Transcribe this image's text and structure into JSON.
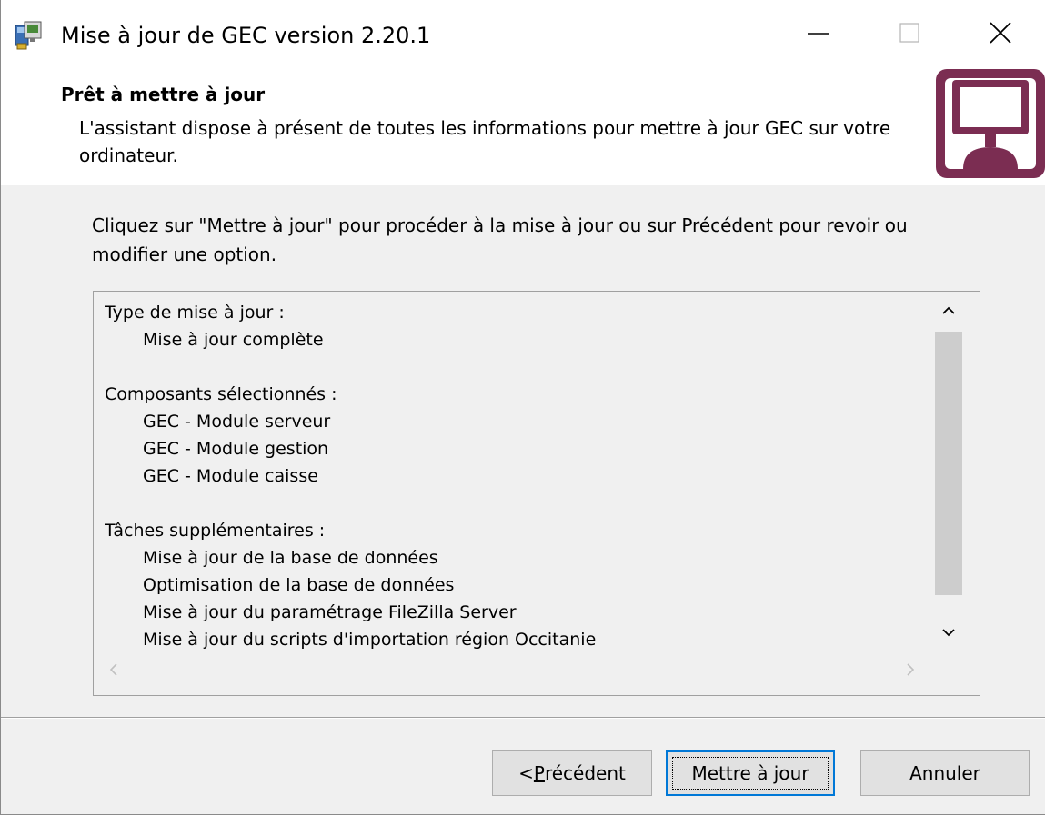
{
  "window": {
    "title": "Mise à jour de GEC version 2.20.1"
  },
  "titlebar": {
    "icons": [
      "installer-app-icon",
      "minimize-icon",
      "maximize-icon",
      "close-icon"
    ]
  },
  "header": {
    "title": "Prêt à mettre à jour",
    "description": "L'assistant dispose à présent de toutes les informations pour mettre à jour GEC sur votre ordinateur.",
    "logo_icon": "computer-monitor-logo",
    "logo_color": "#7b2d52"
  },
  "intro": "Cliquez sur \"Mettre à jour\" pour procéder à la mise à jour ou sur Précédent pour revoir ou modifier une option.",
  "summary": {
    "lines": [
      {
        "text": "Type de mise à jour :",
        "indent": false
      },
      {
        "text": "Mise à jour complète",
        "indent": true
      },
      {
        "text": "",
        "indent": false
      },
      {
        "text": "Composants sélectionnés :",
        "indent": false
      },
      {
        "text": "GEC - Module serveur",
        "indent": true
      },
      {
        "text": "GEC - Module gestion",
        "indent": true
      },
      {
        "text": "GEC - Module caisse",
        "indent": true
      },
      {
        "text": "",
        "indent": false
      },
      {
        "text": "Tâches supplémentaires :",
        "indent": false
      },
      {
        "text": "Mise à jour de la base de données",
        "indent": true
      },
      {
        "text": "Optimisation de la base de données",
        "indent": true
      },
      {
        "text": "Mise à jour du paramétrage FileZilla Server",
        "indent": true
      },
      {
        "text": "Mise à jour du scripts d'importation région Occitanie",
        "indent": true
      }
    ]
  },
  "buttons": {
    "previous_prefix": "< ",
    "previous_accel": "P",
    "previous_rest": "récédent",
    "update": "Mettre à jour",
    "cancel": "Annuler"
  },
  "colors": {
    "focus_border": "#0078d7",
    "scroll_thumb": "#cdcdcd"
  }
}
